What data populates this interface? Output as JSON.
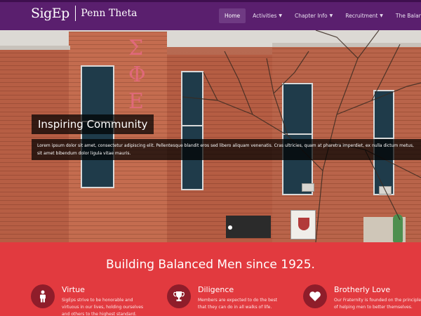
{
  "brand": {
    "logo": "SigEp",
    "chapter": "Penn Theta"
  },
  "nav": {
    "items": [
      {
        "label": "Home",
        "active": true
      },
      {
        "label": "Activities",
        "dropdown": true
      },
      {
        "label": "Chapter Info",
        "dropdown": true
      },
      {
        "label": "Recruitment",
        "dropdown": true
      },
      {
        "label": "The Balanced Ma",
        "dropdown": false
      }
    ]
  },
  "hero": {
    "letters": [
      "Σ",
      "Φ",
      "Ε"
    ],
    "title": "Inspiring Community",
    "text": "Lorem ipsum dolor sit amet, consectetur adipiscing elit. Pellentesque blandit eros sed libero aliquam venenatis. Cras ultricies, quam at pharetra imperdiet, ex nulla dictum metus, sit amet bibendum dolor ligula vitae mauris."
  },
  "section": {
    "title": "Building Balanced Men since 1925.",
    "features": [
      {
        "icon": "person-icon",
        "title": "Virtue",
        "text": "SigEps strive to be honorable and virtuous in our lives, holding ourselves and others to the highest standard."
      },
      {
        "icon": "trophy-icon",
        "title": "Diligence",
        "text": "Members are expected to do the best that they can do in all walks of life."
      },
      {
        "icon": "heart-icon",
        "title": "Brotherly Love",
        "text": "Our Fraternity is founded on the principle of helping men to better themselves."
      }
    ]
  },
  "colors": {
    "nav_bg": "#5a1f6e",
    "section_bg": "#e23a3f",
    "icon_bg": "#8f1d2a"
  }
}
